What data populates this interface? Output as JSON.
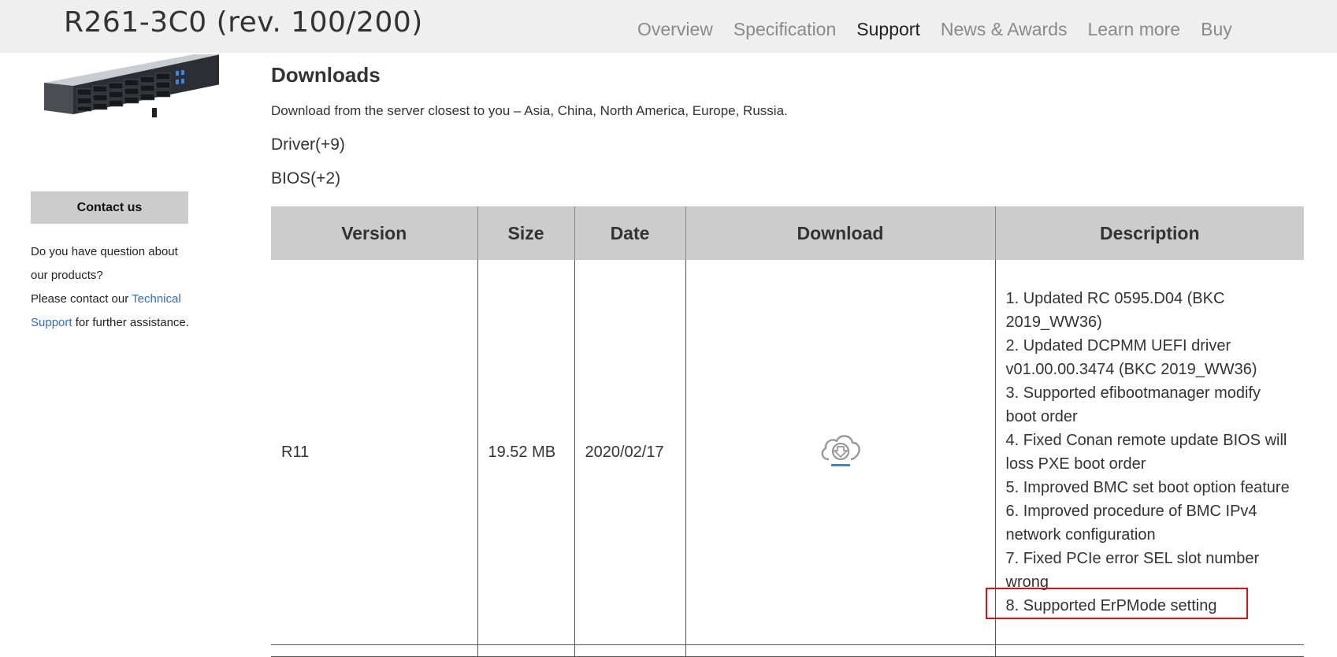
{
  "header": {
    "product_title": "R261-3C0 (rev. 100/200)",
    "nav": [
      {
        "label": "Overview",
        "active": false
      },
      {
        "label": "Specification",
        "active": false
      },
      {
        "label": "Support",
        "active": true
      },
      {
        "label": "News & Awards",
        "active": false
      },
      {
        "label": "Learn more",
        "active": false
      },
      {
        "label": "Buy",
        "active": false
      }
    ]
  },
  "sidebar": {
    "contact_label": "Contact us",
    "question_text": "Do you have question about our products?",
    "contact_prefix": "Please contact our ",
    "contact_link": "Technical Support",
    "contact_suffix": " for further assistance."
  },
  "downloads": {
    "title": "Downloads",
    "subtitle": "Download from the server closest to you – Asia, China, North America, Europe, Russia.",
    "sections": [
      "Driver(+9)",
      "BIOS(+2)"
    ],
    "table": {
      "columns": [
        "Version",
        "Size",
        "Date",
        "Download",
        "Description"
      ],
      "rows": [
        {
          "version": "R11",
          "size": "19.52 MB",
          "date": "2020/02/17",
          "download_icon": "cloud-download-icon",
          "description": [
            "1. Updated RC 0595.D04 (BKC 2019_WW36)",
            "2. Updated DCPMM UEFI driver v01.00.00.3474 (BKC 2019_WW36)",
            "3. Supported efibootmanager modify boot order",
            "4. Fixed Conan remote update BIOS will loss PXE boot order",
            "5. Improved BMC set boot option feature",
            "6. Improved procedure of BMC IPv4 network configuration",
            "7. Fixed PCIe error SEL slot number wrong",
            "8. Supported ErPMode setting"
          ]
        }
      ]
    }
  },
  "colors": {
    "header_bg": "#efefef",
    "table_header_bg": "#cccccc",
    "link": "#2f6bd1",
    "highlight_border": "#e01010",
    "icon_accent": "#2a8fd8"
  }
}
